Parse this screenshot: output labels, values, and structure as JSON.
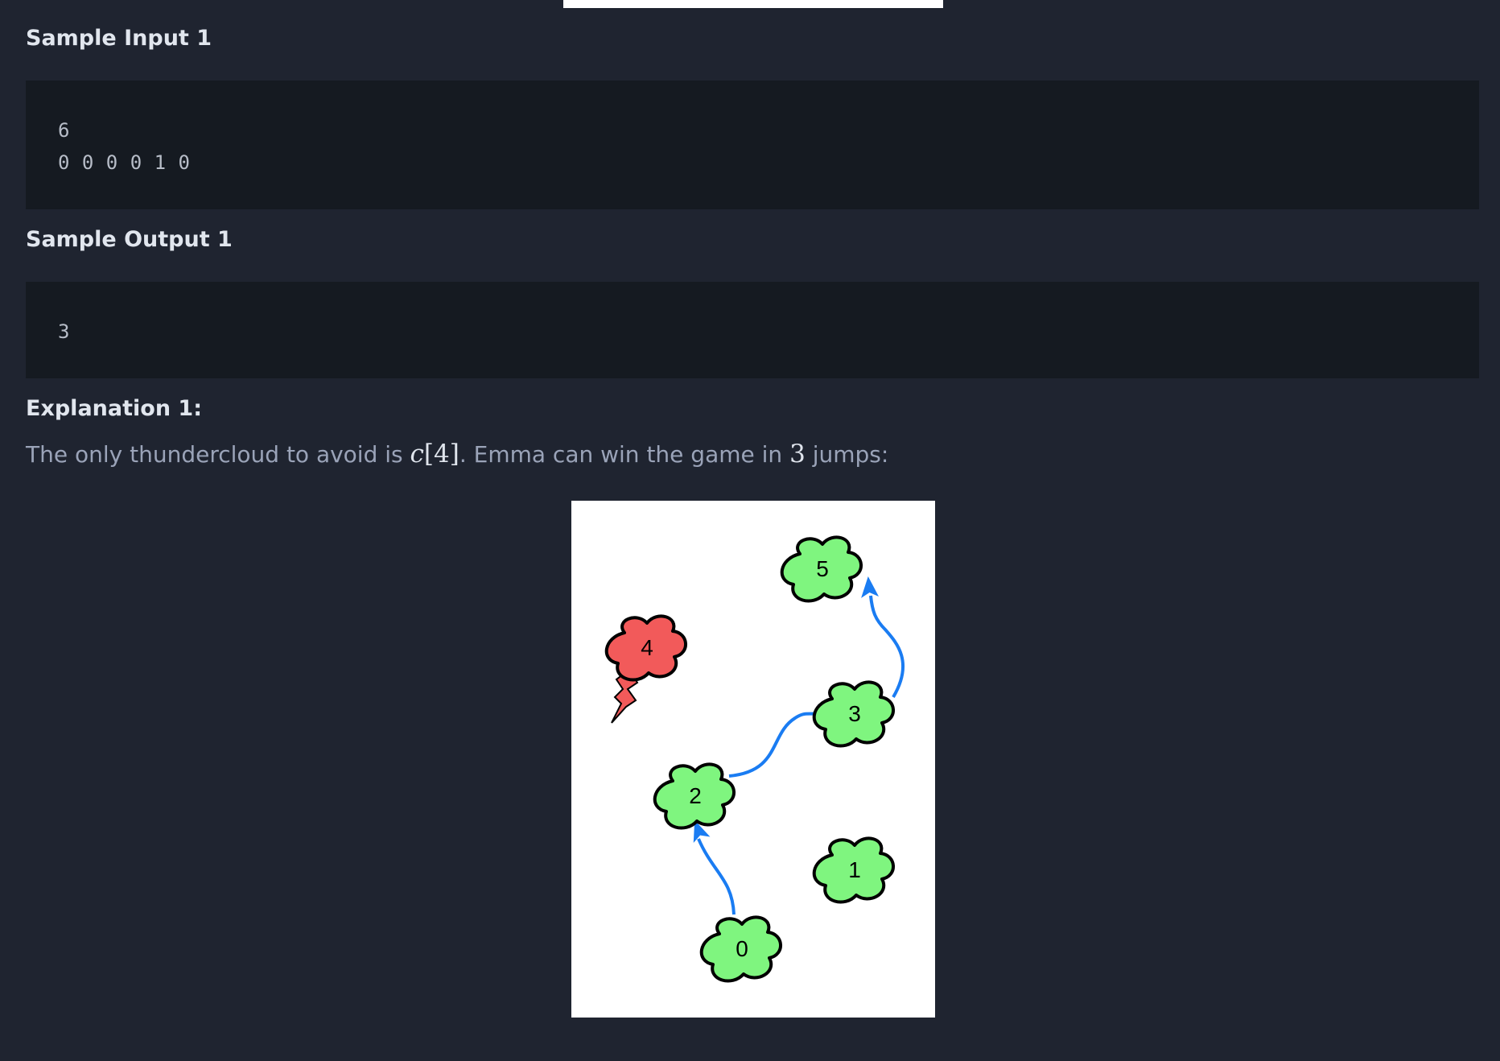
{
  "sample_input": {
    "heading": "Sample Input 1",
    "lines": [
      "6",
      "0 0 0 0 1 0"
    ]
  },
  "sample_output": {
    "heading": "Sample Output 1",
    "lines": [
      "3"
    ]
  },
  "explanation": {
    "heading": "Explanation 1:",
    "text_before": "The only thundercloud to avoid is ",
    "math_var": "c",
    "math_index": "[4]",
    "text_middle": ". Emma can win the game in ",
    "math_jumps": "3",
    "text_after": " jumps:"
  },
  "figure": {
    "clouds": [
      {
        "label": "0",
        "kind": "safe"
      },
      {
        "label": "1",
        "kind": "safe"
      },
      {
        "label": "2",
        "kind": "safe"
      },
      {
        "label": "3",
        "kind": "safe"
      },
      {
        "label": "4",
        "kind": "thunder"
      },
      {
        "label": "5",
        "kind": "safe"
      }
    ],
    "jumps": [
      [
        "0",
        "2"
      ],
      [
        "2",
        "3"
      ],
      [
        "3",
        "5"
      ]
    ],
    "colors": {
      "safe_cloud": "#7ff57f",
      "thunder_cloud": "#f25a5a",
      "arrow": "#1a7cf2",
      "outline": "#000000"
    }
  }
}
